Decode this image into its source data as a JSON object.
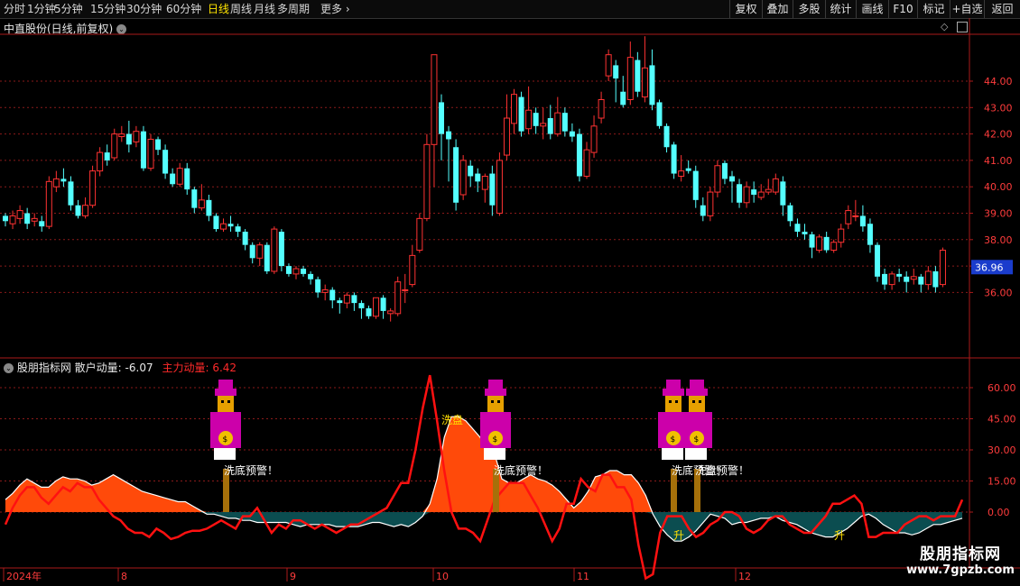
{
  "toolbar": {
    "periods": [
      "分时",
      "1分钟",
      "5分钟",
      "15分钟",
      "30分钟",
      "60分钟",
      "日线",
      "周线",
      "月线",
      "多周期",
      "更多"
    ],
    "active_period": "日线",
    "buttons": [
      "复权",
      "叠加",
      "多股",
      "统计",
      "画线",
      "F10",
      "标记",
      "+自选",
      "返回"
    ]
  },
  "main_chart": {
    "title": "中直股份(日线,前复权)",
    "price_labels": [
      "44.00",
      "43.00",
      "42.00",
      "41.00",
      "40.00",
      "39.00",
      "38.00",
      "37.00",
      "36.00"
    ],
    "last_price": "36.96"
  },
  "indicator": {
    "name": "股朋指标网",
    "retail_label": "散户动量:",
    "retail_value": "-6.07",
    "main_label": "主力动量:",
    "main_value": "6.42",
    "y_labels": [
      "60.00",
      "45.00",
      "30.00",
      "15.00",
      "0.00"
    ],
    "signals": [
      "洗底预警！",
      "洗底预警！",
      "洗底预警！",
      "洗盘预警！"
    ],
    "wash_label": "洗盘",
    "up_label": "升",
    "watermark_cn": "股朋指标网",
    "watermark_url": "www.7gpzb.com"
  },
  "x_axis": {
    "labels": [
      "2024年",
      "8",
      "9",
      "10",
      "11",
      "12"
    ]
  },
  "colors": {
    "up": "#ff3232",
    "down": "#54ffff",
    "grid": "#8a1a1a",
    "main_fill": "#ff4a0a",
    "retail_fill": "#0b4d50",
    "retail_line": "#ffffff",
    "main_line": "#ff1111"
  }
}
